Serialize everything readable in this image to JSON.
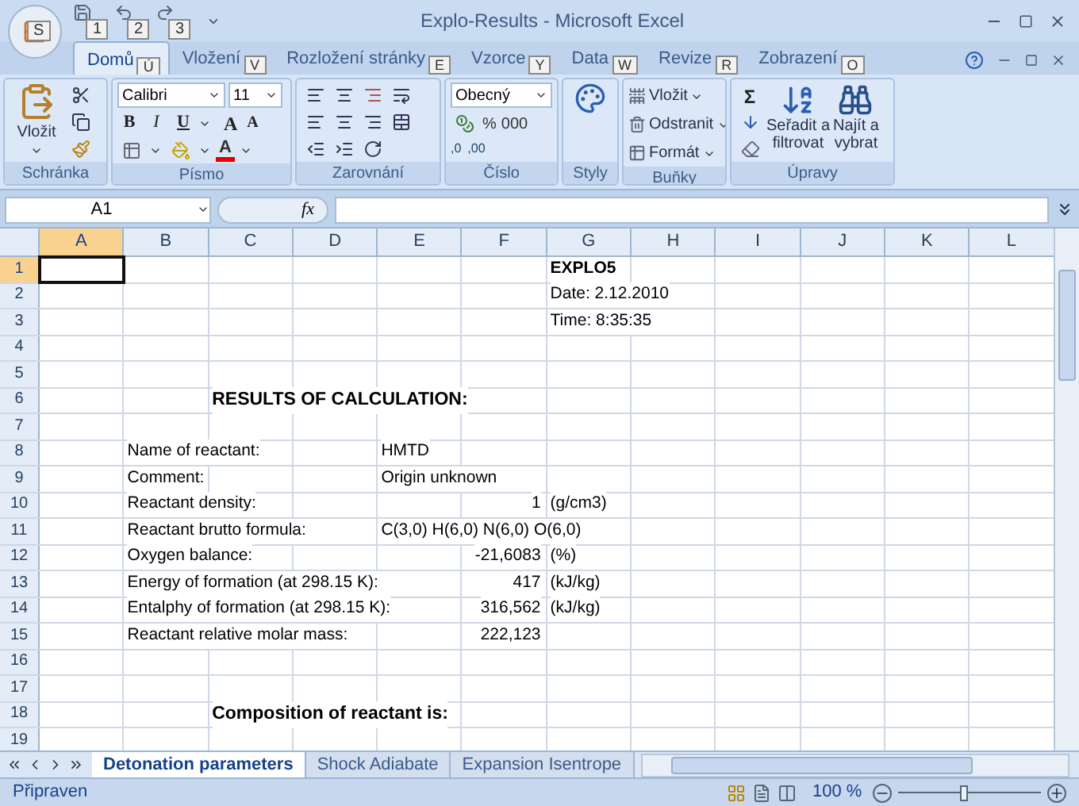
{
  "window": {
    "title": "Explo-Results - Microsoft Excel"
  },
  "office_button": {
    "key_tip": "S"
  },
  "quick_access": [
    {
      "key_tip": "1"
    },
    {
      "key_tip": "2"
    },
    {
      "key_tip": "3"
    }
  ],
  "tabs": [
    {
      "label": "Domů",
      "key_tip": "Ú",
      "selected": true
    },
    {
      "label": "Vložení",
      "key_tip": "V",
      "selected": false
    },
    {
      "label": "Rozložení stránky",
      "key_tip": "E",
      "selected": false
    },
    {
      "label": "Vzorce",
      "key_tip": "Y",
      "selected": false
    },
    {
      "label": "Data",
      "key_tip": "W",
      "selected": false
    },
    {
      "label": "Revize",
      "key_tip": "R",
      "selected": false
    },
    {
      "label": "Zobrazení",
      "key_tip": "O",
      "selected": false
    }
  ],
  "ribbon": {
    "clipboard": {
      "label": "Schránka",
      "paste": "Vložit"
    },
    "font": {
      "label": "Písmo",
      "family": "Calibri",
      "size": "11",
      "bold": "B",
      "italic": "I",
      "underline": "U",
      "grow": "A",
      "shrink": "A",
      "font_color_letter": "A"
    },
    "alignment": {
      "label": "Zarovnání"
    },
    "number": {
      "label": "Číslo",
      "format": "Obecný",
      "percent": "%",
      "thousands": "000",
      "more_decimals": ",0",
      "fewer_decimals": ",00"
    },
    "styles": {
      "label": "Styly"
    },
    "cells": {
      "label": "Buňky",
      "items": [
        "Vložit",
        "Odstranit",
        "Formát"
      ]
    },
    "editing": {
      "label": "Úpravy",
      "sum": "Σ",
      "sort": [
        "Seřadit a",
        "filtrovat"
      ],
      "find": [
        "Najít a",
        "vybrat"
      ]
    }
  },
  "formula_bar": {
    "name_box": "A1",
    "fx": "fx"
  },
  "columns": [
    {
      "label": "A",
      "selected": true
    },
    {
      "label": "B",
      "selected": false
    },
    {
      "label": "C",
      "selected": false
    },
    {
      "label": "D",
      "selected": false
    },
    {
      "label": "E",
      "selected": false
    },
    {
      "label": "F",
      "selected": false
    },
    {
      "label": "G",
      "selected": false
    },
    {
      "label": "H",
      "selected": false
    },
    {
      "label": "I",
      "selected": false
    },
    {
      "label": "J",
      "selected": false
    },
    {
      "label": "K",
      "selected": false
    },
    {
      "label": "L",
      "selected": false
    }
  ],
  "rows": [
    {
      "number": "1",
      "selected": true,
      "cells": {
        "G": {
          "text": "EXPLO5",
          "kind": "bold"
        }
      }
    },
    {
      "number": "2",
      "selected": false,
      "cells": {
        "G": {
          "text": "Date: 2.12.2010",
          "kind": "text"
        }
      }
    },
    {
      "number": "3",
      "selected": false,
      "cells": {
        "G": {
          "text": "Time: 8:35:35",
          "kind": "text"
        }
      }
    },
    {
      "number": "4",
      "selected": false,
      "cells": {}
    },
    {
      "number": "5",
      "selected": false,
      "cells": {}
    },
    {
      "number": "6",
      "selected": false,
      "cells": {
        "C": {
          "text": "RESULTS OF CALCULATION:",
          "kind": "heading"
        }
      }
    },
    {
      "number": "7",
      "selected": false,
      "cells": {}
    },
    {
      "number": "8",
      "selected": false,
      "cells": {
        "B": {
          "text": "Name of reactant:",
          "kind": "text"
        },
        "E": {
          "text": "HMTD",
          "kind": "text"
        }
      }
    },
    {
      "number": "9",
      "selected": false,
      "cells": {
        "B": {
          "text": "Comment:",
          "kind": "text"
        },
        "E": {
          "text": "Origin unknown",
          "kind": "text"
        }
      }
    },
    {
      "number": "10",
      "selected": false,
      "cells": {
        "B": {
          "text": "Reactant density:",
          "kind": "text"
        },
        "F": {
          "text": "1",
          "kind": "number"
        },
        "G": {
          "text": "(g/cm3)",
          "kind": "text"
        }
      }
    },
    {
      "number": "11",
      "selected": false,
      "cells": {
        "B": {
          "text": "Reactant brutto formula:",
          "kind": "text"
        },
        "E": {
          "text": "C(3,0) H(6,0) N(6,0) O(6,0)",
          "kind": "text"
        }
      }
    },
    {
      "number": "12",
      "selected": false,
      "cells": {
        "B": {
          "text": "Oxygen balance:",
          "kind": "text"
        },
        "F": {
          "text": "-21,6083",
          "kind": "number"
        },
        "G": {
          "text": "(%)",
          "kind": "text"
        }
      }
    },
    {
      "number": "13",
      "selected": false,
      "cells": {
        "B": {
          "text": "Energy of formation (at 298.15 K):",
          "kind": "text"
        },
        "F": {
          "text": "417",
          "kind": "number"
        },
        "G": {
          "text": "(kJ/kg)",
          "kind": "text"
        }
      }
    },
    {
      "number": "14",
      "selected": false,
      "cells": {
        "B": {
          "text": "Entalphy of formation (at 298.15 K):",
          "kind": "text"
        },
        "F": {
          "text": "316,562",
          "kind": "number"
        },
        "G": {
          "text": "(kJ/kg)",
          "kind": "text"
        }
      }
    },
    {
      "number": "15",
      "selected": false,
      "cells": {
        "B": {
          "text": "Reactant relative molar mass:",
          "kind": "text"
        },
        "F": {
          "text": "222,123",
          "kind": "number"
        }
      }
    },
    {
      "number": "16",
      "selected": false,
      "cells": {}
    },
    {
      "number": "17",
      "selected": false,
      "cells": {}
    },
    {
      "number": "18",
      "selected": false,
      "cells": {
        "C": {
          "text": "Composition of reactant is:",
          "kind": "heading"
        }
      }
    },
    {
      "number": "19",
      "selected": false,
      "cells": {}
    }
  ],
  "sheet_tabs": [
    {
      "label": "Detonation parameters",
      "selected": true
    },
    {
      "label": "Shock Adiabate",
      "selected": false
    },
    {
      "label": "Expansion Isentrope",
      "selected": false
    }
  ],
  "status_bar": {
    "status": "Připraven",
    "zoom": "100 %",
    "level": 0.46
  }
}
